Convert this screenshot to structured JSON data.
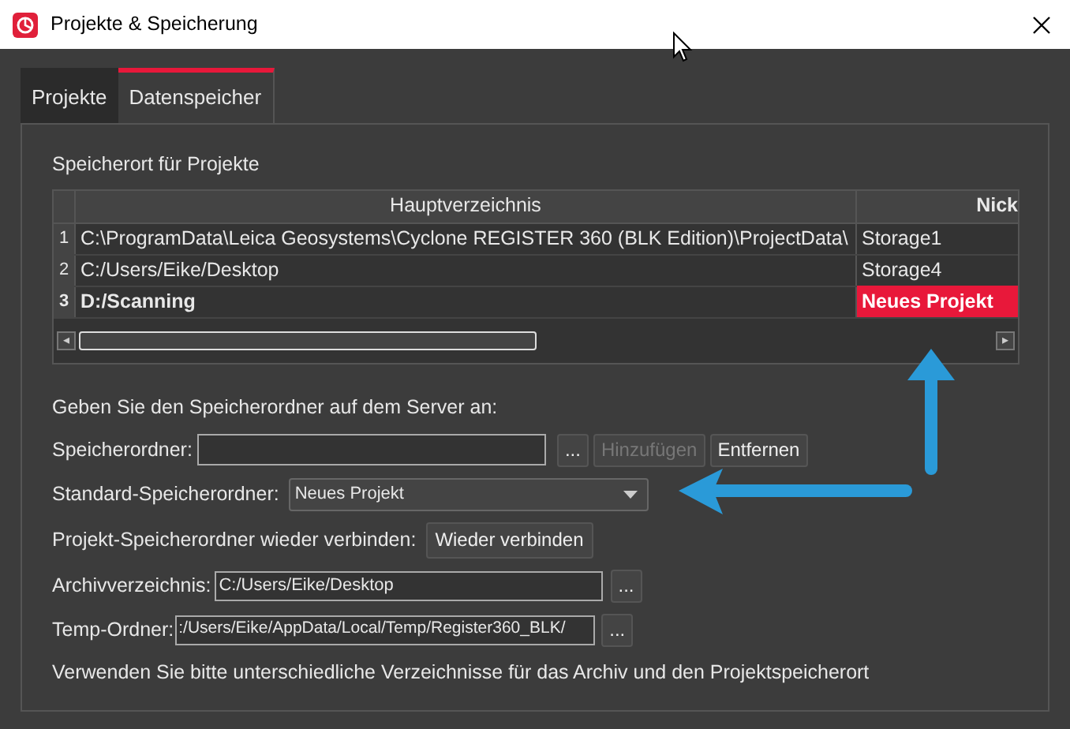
{
  "window": {
    "title": "Projekte & Speicherung"
  },
  "tabs": [
    {
      "label": "Projekte",
      "selected": false
    },
    {
      "label": "Datenspeicher",
      "selected": true
    }
  ],
  "storage": {
    "label": "Speicherort für Projekte",
    "columns": [
      "Hauptverzeichnis",
      "Nick"
    ],
    "rows": [
      {
        "number": "1",
        "path": "C:\\ProgramData\\Leica Geosystems\\Cyclone REGISTER 360 (BLK Edition)\\ProjectData\\",
        "nickname": "Storage1",
        "is_default": false
      },
      {
        "number": "2",
        "path": "C:/Users/Eike/Desktop",
        "nickname": "Storage4",
        "is_default": false
      },
      {
        "number": "3",
        "path": "D:/Scanning",
        "nickname": "Neues Projekt",
        "is_default": true
      }
    ],
    "scroll_left": "◂",
    "scroll_right": "▸"
  },
  "server_hint": "Geben Sie den Speicherordner auf dem Server an:",
  "folder": {
    "label": "Speicherordner:",
    "browse": "...",
    "add": {
      "label": "Hinzufügen",
      "disabled": true
    },
    "remove": {
      "label": "Entfernen",
      "disabled": false
    }
  },
  "default_folder": {
    "label": "Standard-Speicherordner:",
    "value": "Neues Projekt"
  },
  "reconnect": {
    "label": "Projekt-Speicherordner wieder verbinden:",
    "button": "Wieder verbinden"
  },
  "archive": {
    "label": "Archivverzeichnis:",
    "value": "C:/Users/Eike/Desktop",
    "browse": "..."
  },
  "temp": {
    "label": "Temp-Ordner:",
    "value": ":/Users/Eike/AppData/Local/Temp/Register360_BLK/",
    "browse": "..."
  },
  "note": "Verwenden Sie bitte unterschiedliche Verzeichnisse für das Archiv und den Projektspeicherort"
}
